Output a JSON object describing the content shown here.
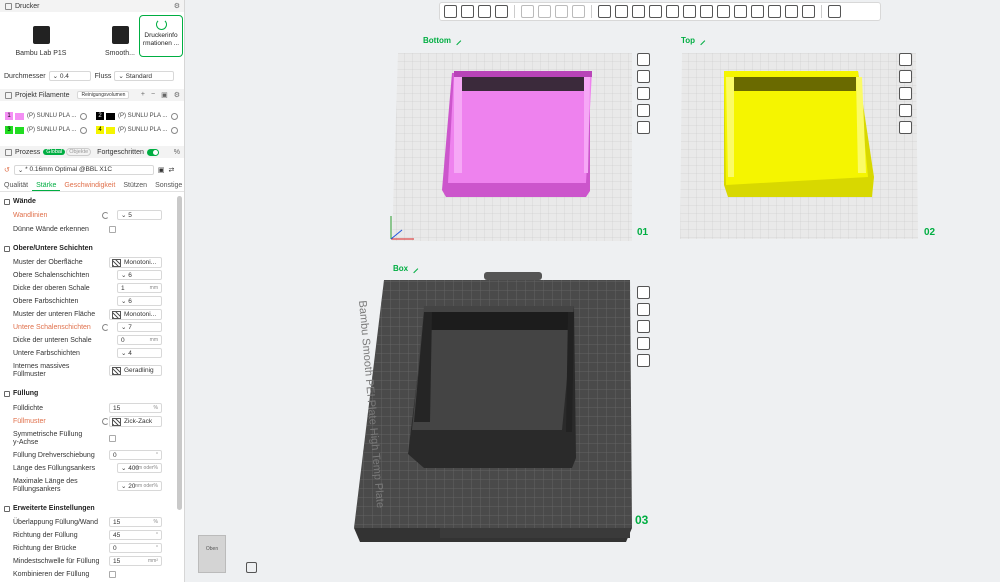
{
  "printer": {
    "section_title": "Drucker",
    "cards": [
      {
        "label": "Bambu Lab P1S"
      },
      {
        "label": "Smooth..."
      }
    ],
    "info_label_1": "Druckerinfo",
    "info_label_2": "rmationen ..."
  },
  "nozzle": {
    "diameter_label": "Durchmesser",
    "diameter_value": "0.4",
    "flow_label": "Fluss",
    "flow_value": "Standard"
  },
  "filaments": {
    "section_title": "Projekt Filamente",
    "cleaning_button": "Reinigungsvolumen",
    "items": [
      {
        "num": "1",
        "label": "(P) SUNLU PLA ...",
        "color": "#f48ff4"
      },
      {
        "num": "2",
        "label": "(P) SUNLU PLA ...",
        "color": "#000000"
      },
      {
        "num": "3",
        "label": "(P) SUNLU PLA ...",
        "color": "#22dd22"
      },
      {
        "num": "4",
        "label": "(P) SUNLU PLA ...",
        "color": "#f5f500"
      }
    ]
  },
  "process": {
    "section_title": "Prozess",
    "global_label": "Global",
    "object_label": "Objekte",
    "advanced_label": "Fortgeschritten",
    "preset": "* 0.16mm Optimal @BBL X1C"
  },
  "tabs": [
    {
      "label": "Qualität",
      "active": false
    },
    {
      "label": "Stärke",
      "active": true
    },
    {
      "label": "Geschwindigkeit",
      "active": false
    },
    {
      "label": "Stützen",
      "active": false
    },
    {
      "label": "Sonstige",
      "active": false
    }
  ],
  "settings": {
    "walls": {
      "title": "Wände",
      "wall_loops_label": "Wandlinien",
      "wall_loops_value": "5",
      "detect_thin_label": "Dünne Wände erkennen"
    },
    "shells": {
      "title": "Obere/Untere Schichten",
      "top_pattern_label": "Muster der Oberfläche",
      "top_pattern_value": "Monotoni...",
      "top_layers_label": "Obere Schalenschichten",
      "top_layers_value": "6",
      "top_thickness_label": "Dicke der oberen Schale",
      "top_thickness_value": "1",
      "top_thickness_unit": "mm",
      "top_color_layers_label": "Obere Farbschichten",
      "top_color_layers_value": "6",
      "bottom_pattern_label": "Muster der unteren Fläche",
      "bottom_pattern_value": "Monotoni...",
      "bottom_layers_label": "Untere Schalenschichten",
      "bottom_layers_value": "7",
      "bottom_thickness_label": "Dicke der unteren Schale",
      "bottom_thickness_value": "0",
      "bottom_thickness_unit": "mm",
      "bottom_color_layers_label": "Untere Farbschichten",
      "bottom_color_layers_value": "4",
      "internal_solid_label_1": "Internes massives",
      "internal_solid_label_2": "Füllmuster",
      "internal_solid_value": "Geradlinig"
    },
    "infill": {
      "title": "Füllung",
      "density_label": "Fülldichte",
      "density_value": "15",
      "density_unit": "%",
      "pattern_label": "Füllmuster",
      "pattern_value": "Zick-Zack",
      "symmetric_label_1": "Symmetrische Füllung",
      "symmetric_label_2": "y-Achse",
      "rotation_label": "Füllung Drehverschiebung",
      "rotation_value": "0",
      "rotation_unit": "°",
      "anchor_label": "Länge des Füllungsankers",
      "anchor_value": "400",
      "anchor_unit": "mm oder%",
      "max_anchor_label_1": "Maximale Länge des",
      "max_anchor_label_2": "Füllungsankers",
      "max_anchor_value": "20",
      "max_anchor_unit": "mm oder%"
    },
    "advanced": {
      "title": "Erweiterte Einstellungen",
      "overlap_label": "Überlappung Füllung/Wand",
      "overlap_value": "15",
      "overlap_unit": "%",
      "direction_label": "Richtung der Füllung",
      "direction_value": "45",
      "direction_unit": "°",
      "bridge_label": "Richtung der Brücke",
      "bridge_value": "0",
      "bridge_unit": "°",
      "min_area_label": "Mindestschwelle für Füllung",
      "min_area_value": "15",
      "min_area_unit": "mm²",
      "combine_label": "Kombinieren der Füllung"
    }
  },
  "plates": [
    {
      "title": "Bottom",
      "number": "01",
      "color": "#ee82ee"
    },
    {
      "title": "Top",
      "number": "02",
      "color": "#f5f500"
    },
    {
      "title": "Box",
      "number": "03",
      "color": "#333333",
      "bed_text": "Bambu Smooth PEI Plate High Temp Plate"
    }
  ],
  "view_cube": {
    "label": "Oben"
  }
}
